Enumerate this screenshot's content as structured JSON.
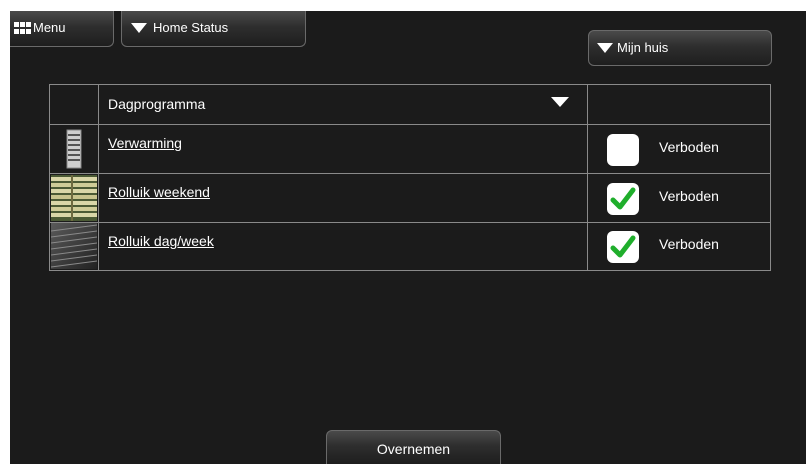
{
  "topbar": {
    "menu_label": "Menu",
    "home_status_label": "Home Status",
    "location_label": "Mijn huis"
  },
  "table": {
    "header": "Dagprogramma",
    "rows": [
      {
        "name": "Verwarming",
        "checked": false,
        "status": "Verboden",
        "icon": "radiator-icon"
      },
      {
        "name": "Rolluik weekend",
        "checked": true,
        "status": "Verboden",
        "icon": "blinds-icon"
      },
      {
        "name": "Rolluik dag/week",
        "checked": true,
        "status": "Verboden",
        "icon": "shutter-icon"
      }
    ]
  },
  "footer": {
    "confirm_label": "Overnemen"
  },
  "colors": {
    "background": "#1b1b1b",
    "check_green": "#1fae2b",
    "grid_line": "#8a8a8a"
  }
}
